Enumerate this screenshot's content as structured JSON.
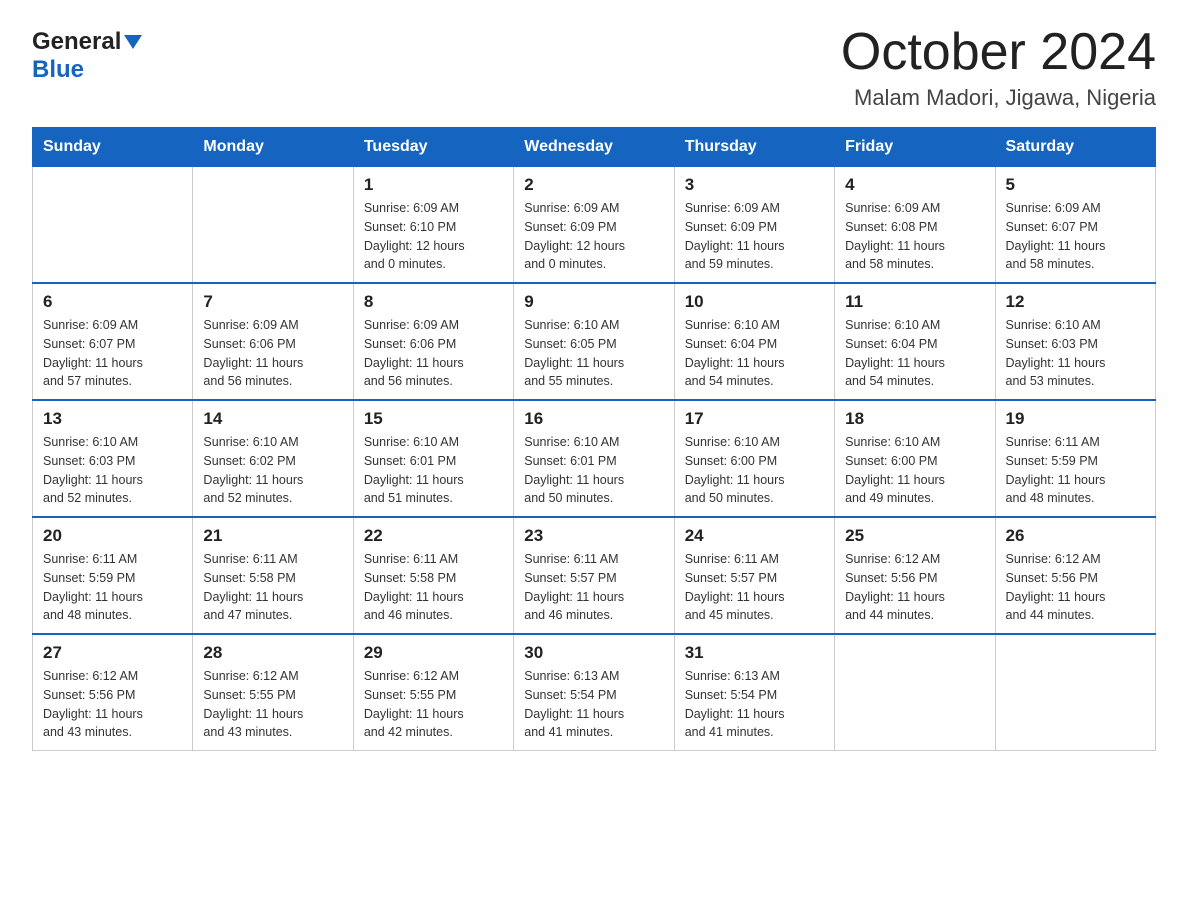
{
  "logo": {
    "general": "General",
    "blue": "Blue"
  },
  "title": "October 2024",
  "subtitle": "Malam Madori, Jigawa, Nigeria",
  "weekdays": [
    "Sunday",
    "Monday",
    "Tuesday",
    "Wednesday",
    "Thursday",
    "Friday",
    "Saturday"
  ],
  "weeks": [
    [
      {
        "day": "",
        "info": ""
      },
      {
        "day": "",
        "info": ""
      },
      {
        "day": "1",
        "info": "Sunrise: 6:09 AM\nSunset: 6:10 PM\nDaylight: 12 hours\nand 0 minutes."
      },
      {
        "day": "2",
        "info": "Sunrise: 6:09 AM\nSunset: 6:09 PM\nDaylight: 12 hours\nand 0 minutes."
      },
      {
        "day": "3",
        "info": "Sunrise: 6:09 AM\nSunset: 6:09 PM\nDaylight: 11 hours\nand 59 minutes."
      },
      {
        "day": "4",
        "info": "Sunrise: 6:09 AM\nSunset: 6:08 PM\nDaylight: 11 hours\nand 58 minutes."
      },
      {
        "day": "5",
        "info": "Sunrise: 6:09 AM\nSunset: 6:07 PM\nDaylight: 11 hours\nand 58 minutes."
      }
    ],
    [
      {
        "day": "6",
        "info": "Sunrise: 6:09 AM\nSunset: 6:07 PM\nDaylight: 11 hours\nand 57 minutes."
      },
      {
        "day": "7",
        "info": "Sunrise: 6:09 AM\nSunset: 6:06 PM\nDaylight: 11 hours\nand 56 minutes."
      },
      {
        "day": "8",
        "info": "Sunrise: 6:09 AM\nSunset: 6:06 PM\nDaylight: 11 hours\nand 56 minutes."
      },
      {
        "day": "9",
        "info": "Sunrise: 6:10 AM\nSunset: 6:05 PM\nDaylight: 11 hours\nand 55 minutes."
      },
      {
        "day": "10",
        "info": "Sunrise: 6:10 AM\nSunset: 6:04 PM\nDaylight: 11 hours\nand 54 minutes."
      },
      {
        "day": "11",
        "info": "Sunrise: 6:10 AM\nSunset: 6:04 PM\nDaylight: 11 hours\nand 54 minutes."
      },
      {
        "day": "12",
        "info": "Sunrise: 6:10 AM\nSunset: 6:03 PM\nDaylight: 11 hours\nand 53 minutes."
      }
    ],
    [
      {
        "day": "13",
        "info": "Sunrise: 6:10 AM\nSunset: 6:03 PM\nDaylight: 11 hours\nand 52 minutes."
      },
      {
        "day": "14",
        "info": "Sunrise: 6:10 AM\nSunset: 6:02 PM\nDaylight: 11 hours\nand 52 minutes."
      },
      {
        "day": "15",
        "info": "Sunrise: 6:10 AM\nSunset: 6:01 PM\nDaylight: 11 hours\nand 51 minutes."
      },
      {
        "day": "16",
        "info": "Sunrise: 6:10 AM\nSunset: 6:01 PM\nDaylight: 11 hours\nand 50 minutes."
      },
      {
        "day": "17",
        "info": "Sunrise: 6:10 AM\nSunset: 6:00 PM\nDaylight: 11 hours\nand 50 minutes."
      },
      {
        "day": "18",
        "info": "Sunrise: 6:10 AM\nSunset: 6:00 PM\nDaylight: 11 hours\nand 49 minutes."
      },
      {
        "day": "19",
        "info": "Sunrise: 6:11 AM\nSunset: 5:59 PM\nDaylight: 11 hours\nand 48 minutes."
      }
    ],
    [
      {
        "day": "20",
        "info": "Sunrise: 6:11 AM\nSunset: 5:59 PM\nDaylight: 11 hours\nand 48 minutes."
      },
      {
        "day": "21",
        "info": "Sunrise: 6:11 AM\nSunset: 5:58 PM\nDaylight: 11 hours\nand 47 minutes."
      },
      {
        "day": "22",
        "info": "Sunrise: 6:11 AM\nSunset: 5:58 PM\nDaylight: 11 hours\nand 46 minutes."
      },
      {
        "day": "23",
        "info": "Sunrise: 6:11 AM\nSunset: 5:57 PM\nDaylight: 11 hours\nand 46 minutes."
      },
      {
        "day": "24",
        "info": "Sunrise: 6:11 AM\nSunset: 5:57 PM\nDaylight: 11 hours\nand 45 minutes."
      },
      {
        "day": "25",
        "info": "Sunrise: 6:12 AM\nSunset: 5:56 PM\nDaylight: 11 hours\nand 44 minutes."
      },
      {
        "day": "26",
        "info": "Sunrise: 6:12 AM\nSunset: 5:56 PM\nDaylight: 11 hours\nand 44 minutes."
      }
    ],
    [
      {
        "day": "27",
        "info": "Sunrise: 6:12 AM\nSunset: 5:56 PM\nDaylight: 11 hours\nand 43 minutes."
      },
      {
        "day": "28",
        "info": "Sunrise: 6:12 AM\nSunset: 5:55 PM\nDaylight: 11 hours\nand 43 minutes."
      },
      {
        "day": "29",
        "info": "Sunrise: 6:12 AM\nSunset: 5:55 PM\nDaylight: 11 hours\nand 42 minutes."
      },
      {
        "day": "30",
        "info": "Sunrise: 6:13 AM\nSunset: 5:54 PM\nDaylight: 11 hours\nand 41 minutes."
      },
      {
        "day": "31",
        "info": "Sunrise: 6:13 AM\nSunset: 5:54 PM\nDaylight: 11 hours\nand 41 minutes."
      },
      {
        "day": "",
        "info": ""
      },
      {
        "day": "",
        "info": ""
      }
    ]
  ]
}
